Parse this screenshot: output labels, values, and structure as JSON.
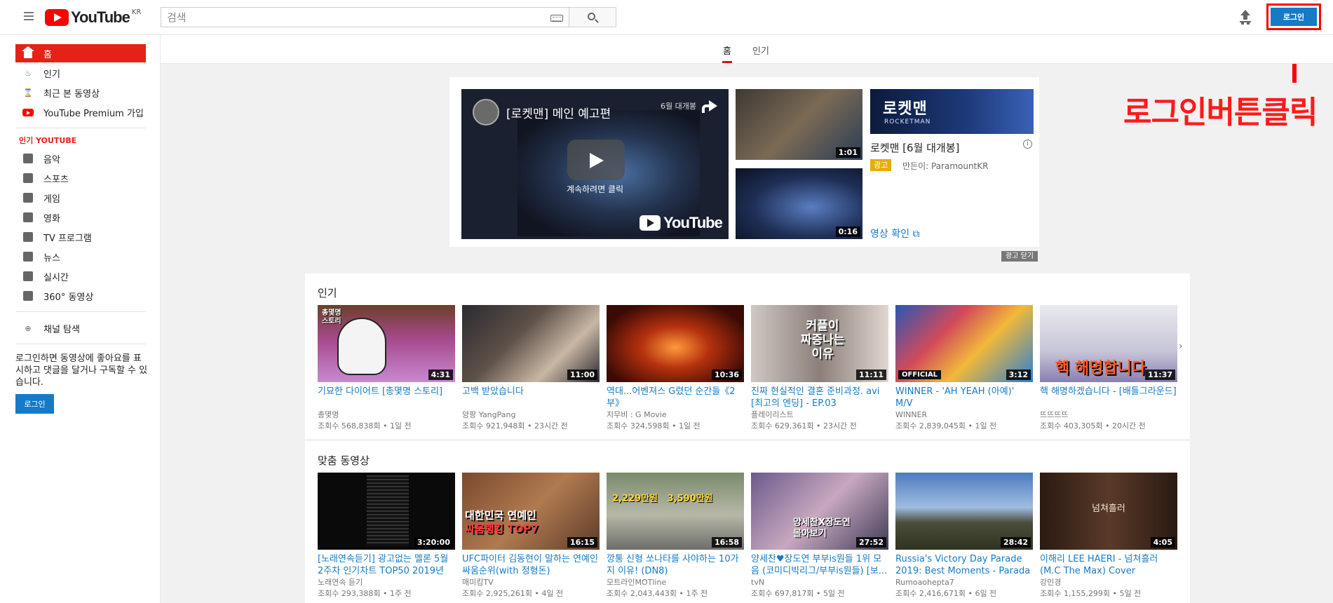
{
  "header": {
    "logo_text": "YouTube",
    "region": "KR",
    "search_placeholder": "검색",
    "login_label": "로그인"
  },
  "annotation": {
    "text": "로그인버튼클릭"
  },
  "sidebar": {
    "items": [
      {
        "label": "홈",
        "icon": "home-icon"
      },
      {
        "label": "인기",
        "icon": "flame-icon"
      },
      {
        "label": "최근 본 동영상",
        "icon": "hourglass-icon"
      },
      {
        "label": "YouTube Premium 가입",
        "icon": "youtube-premium-icon"
      }
    ],
    "section_title": "인기 YOUTUBE",
    "categories": [
      {
        "label": "음악",
        "icon": "music-icon"
      },
      {
        "label": "스포츠",
        "icon": "sports-icon"
      },
      {
        "label": "게임",
        "icon": "gaming-icon"
      },
      {
        "label": "영화",
        "icon": "movie-icon"
      },
      {
        "label": "TV 프로그램",
        "icon": "tv-icon"
      },
      {
        "label": "뉴스",
        "icon": "news-icon"
      },
      {
        "label": "실시간",
        "icon": "live-icon"
      },
      {
        "label": "360° 동영상",
        "icon": "vr-icon"
      }
    ],
    "browse_channels": "채널 탐색",
    "login_message": "로그인하면 동영상에 좋아요를 표시하고 댓글을 달거나 구독할 수 있습니다.",
    "login_label": "로그인"
  },
  "tabs": [
    {
      "label": "홈"
    },
    {
      "label": "인기"
    }
  ],
  "ad": {
    "player_title": "[로켓맨] 메인 예고편",
    "player_corner": "6월 대개봉",
    "continue_text": "계속하려면 클릭",
    "watermark": "YouTube",
    "thumb1_duration": "1:01",
    "thumb2_duration": "0:16",
    "banner_title": "로켓맨",
    "banner_sub": "ROCKETMAN",
    "name": "로켓맨 [6월 대개봉]",
    "badge": "광고",
    "by": "만든이: ParamountKR",
    "link": "영상 확인",
    "close": "광고 닫기"
  },
  "shelves": [
    {
      "title": "인기",
      "videos": [
        {
          "title": "기묘한 다이어트 [총몇명 스토리]",
          "channel": "총몇명",
          "meta": "조회수 568,838회 • 1일 전",
          "duration": "4:31",
          "thumb_text": "총몇명\n스토리"
        },
        {
          "title": "고백 받았습니다",
          "channel": "양팡 YangPang",
          "meta": "조회수 921,948회 • 23시간 전",
          "duration": "11:00",
          "thumb_text": ""
        },
        {
          "title": "역대...어벤져스 G렸던 순간들《2부》",
          "channel": "지무비 : G Movie",
          "meta": "조회수 324,598회 • 1일 전",
          "duration": "10:36",
          "thumb_text": ""
        },
        {
          "title": "진짜 현실적인 결혼 준비과정. avi [최고의 엔딩] - EP.03",
          "channel": "플레이리스트",
          "meta": "조회수 629,361회 • 23시간 전",
          "duration": "11:11",
          "thumb_text": "커플이\n짜증나는\n이유"
        },
        {
          "title": "WINNER - 'AH YEAH (아예)' M/V",
          "channel": "WINNER",
          "meta": "조회수 2,839,045회 • 1일 전",
          "duration": "3:12",
          "thumb_text": "OFFICIAL"
        },
        {
          "title": "핵 해명하겠습니다 - [배틀그라운드]",
          "channel": "뜨뜨뜨뜨",
          "meta": "조회수 403,305회 • 20시간 전",
          "duration": "11:37",
          "thumb_text": "핵 해명합니다"
        }
      ]
    },
    {
      "title": "맞춤 동영상",
      "videos": [
        {
          "title": "[노래연속듣기] 광고없는 멜론 5월 2주차 인기차트 TOP50 2019년 5...",
          "channel": "노래연속 듣기",
          "meta": "조회수 293,388회 • 1주 전",
          "duration": "3:20:00",
          "thumb_text": ""
        },
        {
          "title": "UFC파이터 김동현이 말하는 연예인 싸움순위(with 정형돈)",
          "channel": "매미킴TV",
          "meta": "조회수 2,925,261회 • 4일 전",
          "duration": "16:15",
          "thumb_text": "대한민국 연예인\n싸움랭킹 TOP7"
        },
        {
          "title": "깡통 신형 쏘나타를 사야하는 10가지 이유! (DN8)",
          "channel": "모트라인MOTline",
          "meta": "조회수 2,043,443회 • 1주 전",
          "duration": "16:58",
          "thumb_text": "2,229만원  3,590만원"
        },
        {
          "title": "양세찬♥장도연 부부is뭔들 1위 모음 (코미디빅리그/부부is뭔들) [보...",
          "channel": "tvN",
          "meta": "조회수 697,817회 • 5일 전",
          "duration": "27:52",
          "thumb_text": "양세찬X장도연\n몰아보기"
        },
        {
          "title": "Russia's Victory Day Parade 2019: Best Moments - Parada de...",
          "channel": "Rumoaohepta7",
          "meta": "조회수 2,416,671회 • 6일 전",
          "duration": "28:42",
          "thumb_text": ""
        },
        {
          "title": "이해리 LEE HAERI - 넘쳐흘러(M.C The Max) Cover",
          "channel": "강민경",
          "meta": "조회수 1,155,299회 • 5일 전",
          "duration": "4:05",
          "thumb_text": "넘쳐흘러"
        }
      ]
    }
  ],
  "colors": {
    "accent_red": "#e62117",
    "link_blue": "#167ac6",
    "annotation_red": "#ff1a1a",
    "ad_badge": "#e6ad06"
  }
}
